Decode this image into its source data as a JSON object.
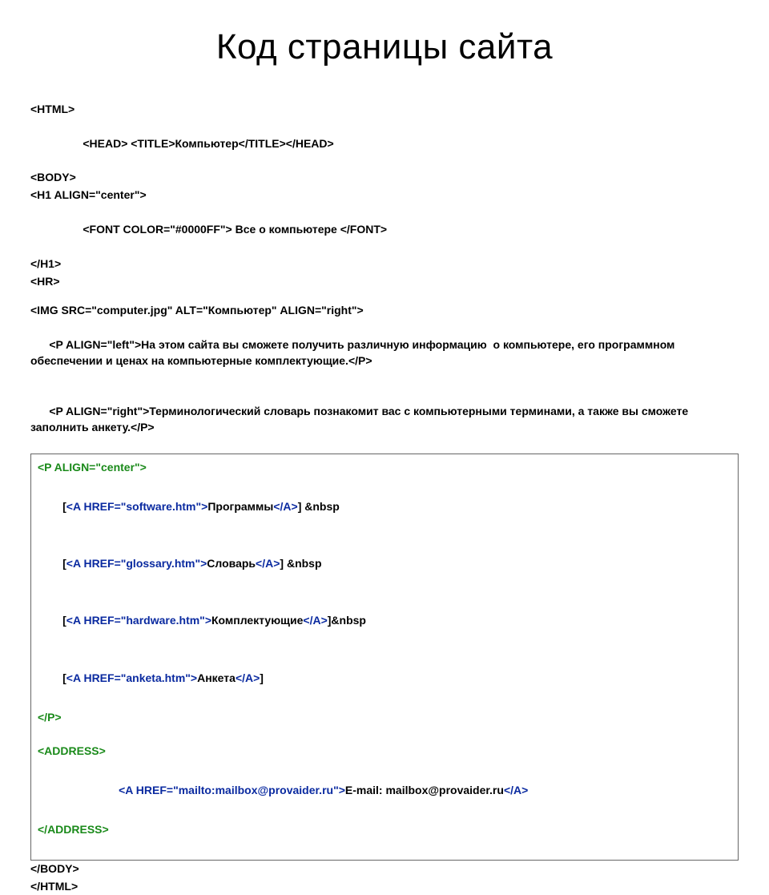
{
  "title": "Код страницы сайта",
  "lines": {
    "l1": "<HTML>",
    "l2_a": "<HEAD> <TITLE>",
    "l2_b": "Компьютер",
    "l2_c": "</TITLE></HEAD>",
    "l3": "<BODY>",
    "l4": "<H1 ALIGN=\"center\">",
    "l5_a": "<FONT COLOR=\"#0000FF\">",
    "l5_b": " Все о компьютере ",
    "l5_c": "</FONT>",
    "l6": "</H1>",
    "l7": "<HR>",
    "l8": "<IMG SRC=\"computer.jpg\" ALT=\"Компьютер\" ALIGN=\"right\">",
    "l9_a": "<P ALIGN=\"left\">",
    "l9_b": "На этом сайта вы сможете получить различную информацию  о компьютере, его программном обеспечении и ценах на компьютерные комплектующие.",
    "l9_c": "</P>",
    "l10_a": "<P ALIGN=\"right\">",
    "l10_b": "Терминологический словарь познакомит вас с компьютерными терминами, а также вы сможете заполнить анкету.",
    "l10_c": "</P>",
    "b1": "<P ALIGN=\"center\">",
    "b2_a": "[",
    "b2_b": "<A HREF=\"software.htm\">",
    "b2_c": "Программы",
    "b2_d": "</A>",
    "b2_e": "] &nbsp",
    "b3_a": "[",
    "b3_b": "<A HREF=\"glossary.htm\">",
    "b3_c": "Словарь",
    "b3_d": "</A>",
    "b3_e": "] &nbsp",
    "b4_a": "[",
    "b4_b": "<A HREF=\"hardware.htm\">",
    "b4_c": "Комплектующие",
    "b4_d": "</A>",
    "b4_e": "]&nbsp",
    "b5_a": "[",
    "b5_b": "<A HREF=\"anketa.htm\">",
    "b5_c": "Анкета",
    "b5_d": "</A>",
    "b5_e": "]",
    "b6": "</P>",
    "b7": "<ADDRESS>",
    "b8_a": "<A HREF=\"mailto:mailbox@provaider.ru\">",
    "b8_b": "E-mail: mailbox@provaider.ru",
    "b8_c": "</A>",
    "b9": "</ADDRESS>",
    "l11": "</BODY>",
    "l12": "</HTML>"
  }
}
